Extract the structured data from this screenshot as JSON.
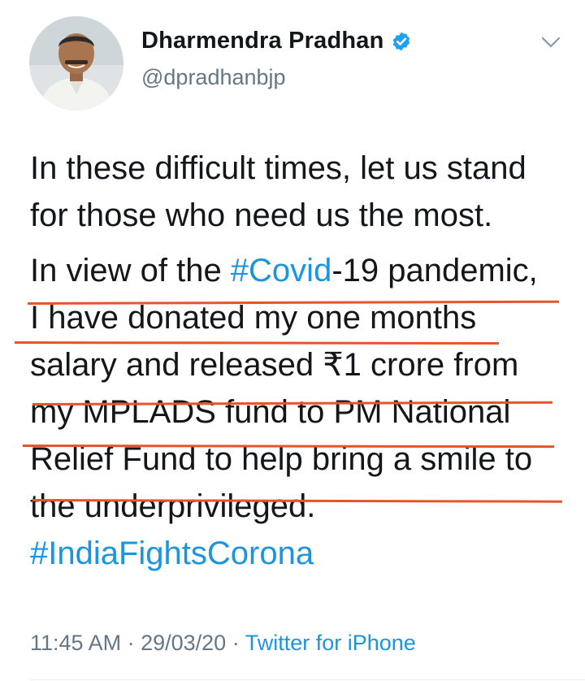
{
  "author": {
    "display_name": "Dharmendra Pradhan",
    "handle": "@dpradhanbjp",
    "verified_icon": "verified-badge-icon",
    "menu_icon": "chevron-down-icon"
  },
  "tweet": {
    "p1": {
      "line1": "In these difficult times, let us stand",
      "line2": "for those who need us the most."
    },
    "p2": {
      "line1_pre": "In view of the ",
      "line1_tag": "#Covid",
      "line1_post": "-19 pandemic,",
      "line2": "I have donated my one months",
      "line3": "salary and released ₹1 crore from",
      "line4": "my MPLADS fund to PM National",
      "line5": "Relief Fund to help bring a smile to",
      "line6": "the underprivileged.",
      "line7_tag": "#IndiaFightsCorona"
    }
  },
  "meta": {
    "time": "11:45 AM",
    "sep1": " · ",
    "date": "29/03/20",
    "sep2": " · ",
    "source": "Twitter for iPhone"
  },
  "colors": {
    "link": "#1b95e0",
    "annotation": "#e8542a",
    "secondary": "#657786"
  }
}
